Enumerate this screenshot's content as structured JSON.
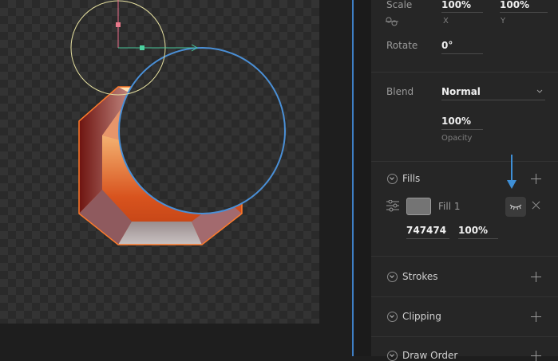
{
  "transform": {
    "scale_label": "Scale",
    "scale_x": "100%",
    "scale_y": "100%",
    "x_caption": "X",
    "y_caption": "Y",
    "rotate_label": "Rotate",
    "rotate_value": "0°"
  },
  "appearance": {
    "blend_label": "Blend",
    "blend_value": "Normal",
    "opacity_value": "100%",
    "opacity_caption": "Opacity"
  },
  "fills": {
    "title": "Fills",
    "fill_name": "Fill 1",
    "fill_hex": "747474",
    "fill_opacity": "100%",
    "fill_color": "#747474"
  },
  "sections": {
    "strokes": "Strokes",
    "clipping": "Clipping",
    "draw_order": "Draw Order"
  },
  "colors": {
    "accent": "#3e7fc5",
    "selection_ellipse": "#4a8fd6"
  }
}
